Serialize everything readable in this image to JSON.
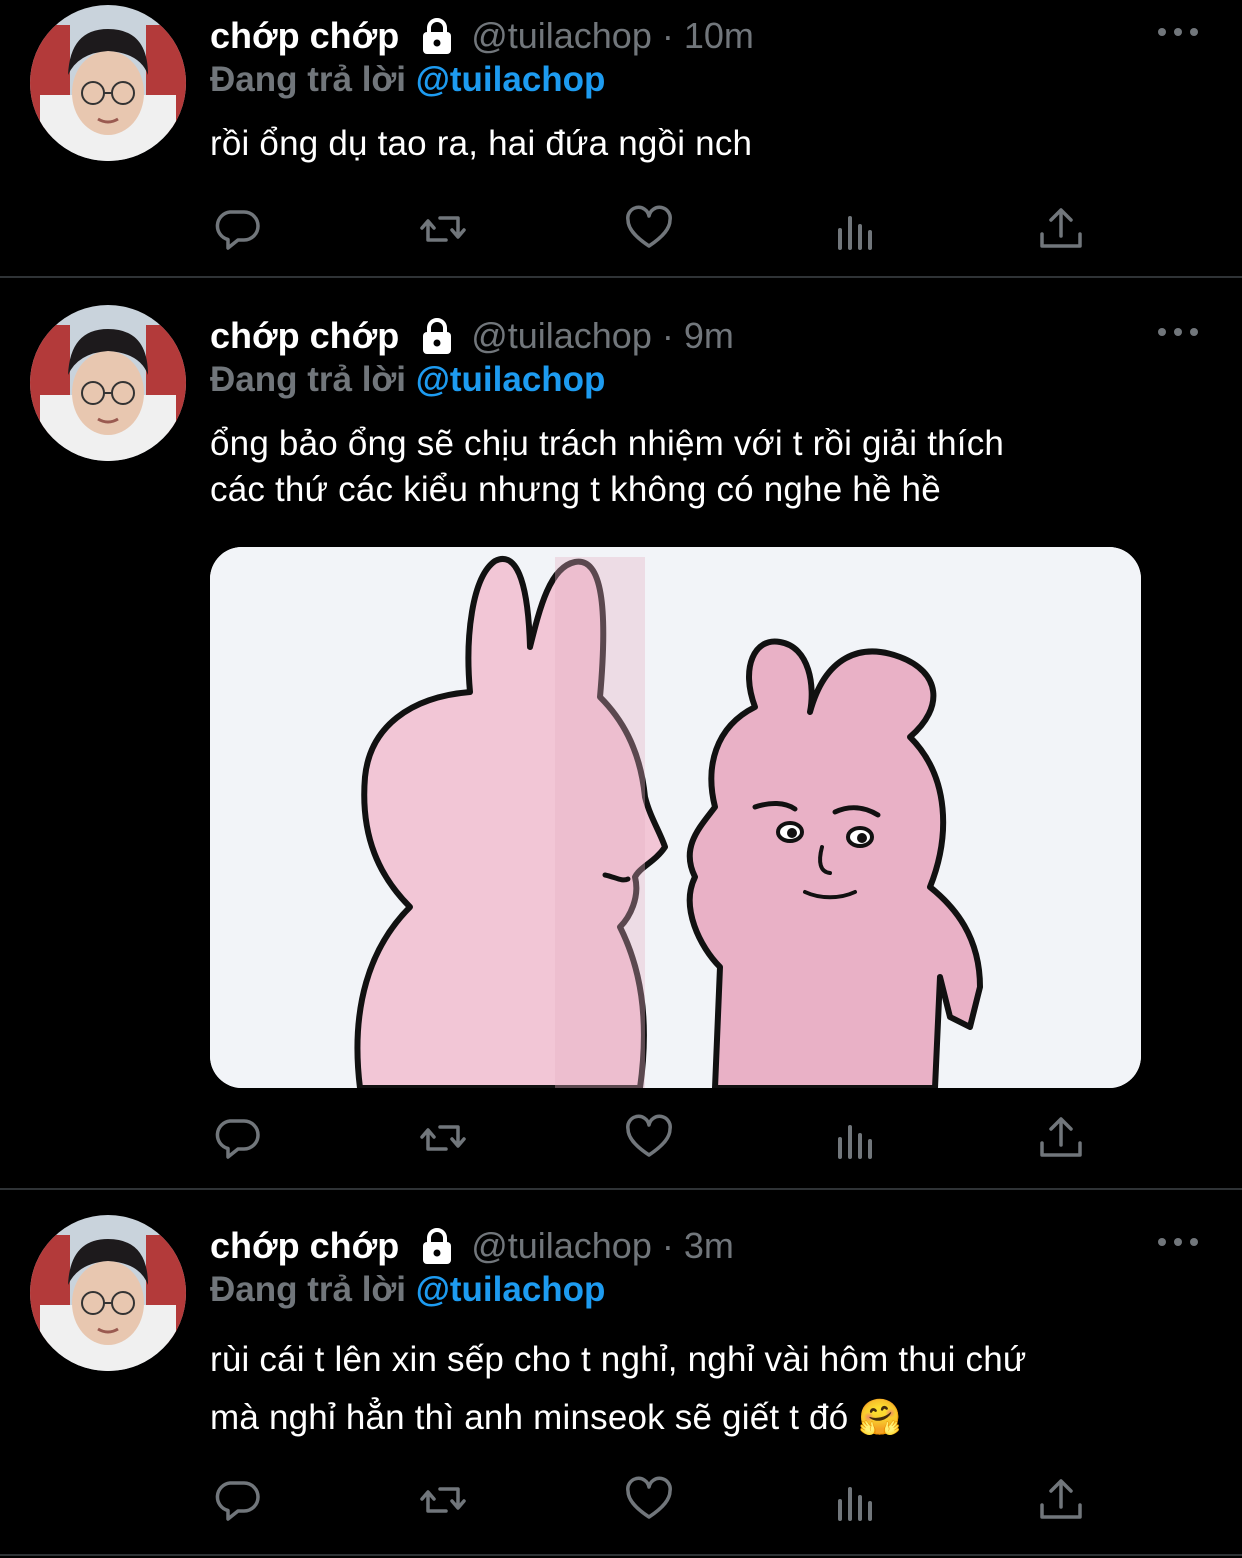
{
  "colors": {
    "background": "#000000",
    "text": "#ffffff",
    "muted": "#71767b",
    "accent": "#1d9bf0",
    "divider": "#2f3336"
  },
  "tweets": [
    {
      "name": "chớp chớp",
      "handle": "@tuilachop",
      "dot": "·",
      "time": "10m",
      "reply_prefix": "Đang trả lời ",
      "reply_to": "@tuilachop",
      "text": "rồi ổng dụ tao ra, hai đứa ngồi nch"
    },
    {
      "name": "chớp chớp",
      "handle": "@tuilachop",
      "dot": "·",
      "time": "9m",
      "reply_prefix": "Đang trả lời ",
      "reply_to": "@tuilachop",
      "text_lines": [
        "ổng bảo ổng sẽ chịu trách nhiệm với t rồi giải thích",
        "các thứ các kiểu nhưng t không có nghe hề hề"
      ]
    },
    {
      "name": "chớp chớp",
      "handle": "@tuilachop",
      "dot": "·",
      "time": "3m",
      "reply_prefix": "Đang trả lời ",
      "reply_to": "@tuilachop",
      "text_lines": [
        "rùi cái t lên xin sếp cho t nghỉ, nghỉ vài hôm thui chứ",
        "mà nghỉ hẳn thì anh minseok sẽ giết t đó 🤗"
      ]
    }
  ],
  "icons": [
    "lock-icon",
    "more-icon",
    "reply-icon",
    "retweet-icon",
    "like-icon",
    "analytics-icon",
    "share-icon"
  ]
}
